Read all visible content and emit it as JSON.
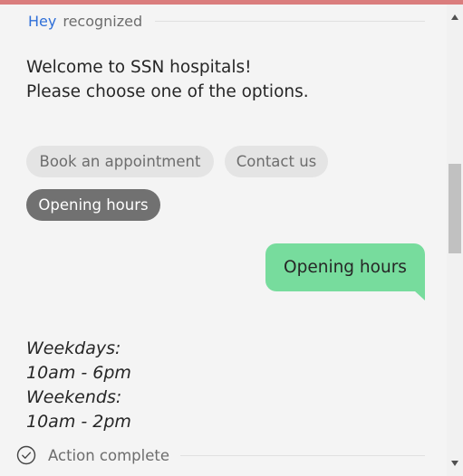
{
  "header": {
    "recognized_prefix": "Hey",
    "recognized_label": "recognized"
  },
  "bot_message": {
    "line1": "Welcome to SSN hospitals!",
    "line2": "Please choose one of the options."
  },
  "options": [
    {
      "label": "Book an appointment",
      "selected": false
    },
    {
      "label": "Contact us",
      "selected": false
    },
    {
      "label": "Opening hours",
      "selected": true
    }
  ],
  "user_message": "Opening hours",
  "hours_reply": {
    "weekdays_label": "Weekdays:",
    "weekdays_hours": "10am - 6pm",
    "weekends_label": "Weekends:",
    "weekends_hours": "10am - 2pm"
  },
  "status": {
    "icon": "check-circle-icon",
    "label": "Action complete"
  },
  "colors": {
    "top_accent": "#da7d7d",
    "hey_accent": "#2f6fd8",
    "user_bubble": "#77dc9d",
    "selected_chip": "#717171",
    "unselected_chip": "#e4e4e4",
    "background": "#f4f4f4"
  }
}
